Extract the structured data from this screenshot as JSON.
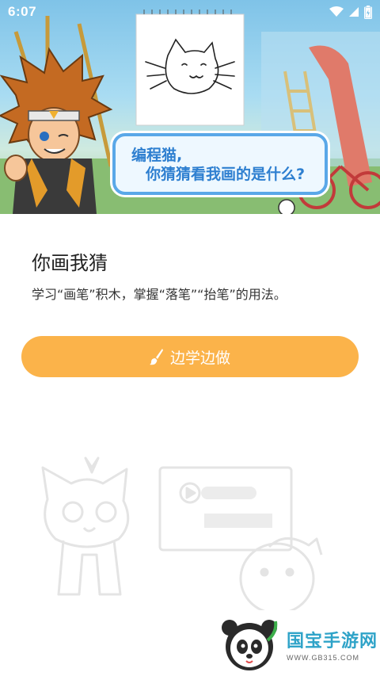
{
  "status_bar": {
    "time": "6:07"
  },
  "hero": {
    "speech_line1": "编程猫,",
    "speech_line2": "你猜猜看我画的是什么?"
  },
  "lesson": {
    "title": "你画我猜",
    "description": "学习“画笔”积木，掌握“落笔”“抬笔”的用法。"
  },
  "cta": {
    "label": "边学边做",
    "icon": "brush-icon",
    "color": "#fbb34a"
  },
  "watermark": {
    "brand": "国宝手游网",
    "url": "WWW.GB315.COM"
  }
}
